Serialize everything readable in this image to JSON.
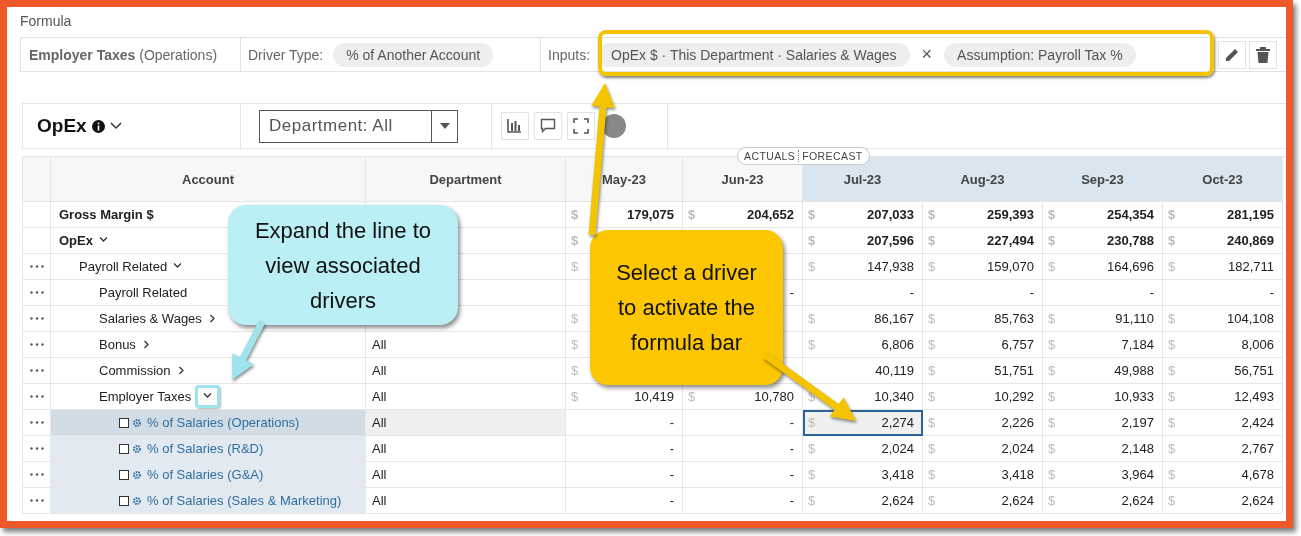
{
  "formula": {
    "title": "Formula",
    "account": "**Employer Taxes** (Operations)",
    "driver_type_label": "Driver Type:",
    "driver_type": "% of Another Account",
    "inputs_label": "Inputs:",
    "inputs": [
      {
        "text": "OpEx $ · This Department · Salaries & Wages"
      },
      {
        "text": "Assumption: Payroll Tax %"
      }
    ],
    "operator": "×"
  },
  "toolbar": {
    "title": "OpEx",
    "department_filter": "Department: All"
  },
  "table": {
    "period_divider": {
      "actuals": "ACTUALS",
      "forecast": "FORECAST"
    },
    "label_columns": [
      {
        "label": "Account"
      },
      {
        "label": "Department"
      }
    ],
    "period_columns": [
      {
        "label": "May-23",
        "kind": "actual"
      },
      {
        "label": "Jun-23",
        "kind": "actual"
      },
      {
        "label": "Jul-23",
        "kind": "forecast"
      },
      {
        "label": "Aug-23",
        "kind": "forecast"
      },
      {
        "label": "Sep-23",
        "kind": "forecast"
      },
      {
        "label": "Oct-23",
        "kind": "forecast"
      }
    ],
    "rows": [
      {
        "account": "Gross Margin $",
        "kind": "line",
        "bold": true,
        "dots": false,
        "cells": [
          {
            "currency": "$",
            "amount": "179,075"
          },
          {
            "currency": "$",
            "amount": "204,652"
          },
          {
            "currency": "$",
            "amount": "207,033"
          },
          {
            "currency": "$",
            "amount": "259,393"
          },
          {
            "currency": "$",
            "amount": "254,354"
          },
          {
            "currency": "$",
            "amount": "281,195"
          }
        ]
      },
      {
        "account": "OpEx",
        "kind": "group",
        "expanded": true,
        "bold": true,
        "dots": false,
        "cells": [
          {
            "currency": "$"
          },
          null,
          {
            "currency": "$",
            "amount": "207,596"
          },
          {
            "currency": "$",
            "amount": "227,494"
          },
          {
            "currency": "$",
            "amount": "230,788"
          },
          {
            "currency": "$",
            "amount": "240,869"
          }
        ],
        "children": [
          {
            "account": "Payroll Related",
            "kind": "group",
            "expanded": true,
            "bold": false,
            "dots": true,
            "cells": [
              {
                "currency": "$"
              },
              null,
              {
                "currency": "$",
                "amount": "147,938"
              },
              {
                "currency": "$",
                "amount": "159,070"
              },
              {
                "currency": "$",
                "amount": "164,696"
              },
              {
                "currency": "$",
                "amount": "182,711"
              }
            ],
            "children": [
              {
                "account": "Payroll Related",
                "kind": "line",
                "bold": false,
                "dots": true,
                "cells": [
                  null,
                  {
                    "amount": "-"
                  },
                  {
                    "amount": "-"
                  },
                  {
                    "amount": "-"
                  },
                  {
                    "amount": "-"
                  },
                  {
                    "amount": "-"
                  }
                ]
              },
              {
                "account": "Salaries & Wages",
                "kind": "group",
                "expanded": false,
                "bold": false,
                "dots": true,
                "cells": [
                  {
                    "currency": "$"
                  },
                  null,
                  {
                    "currency": "$",
                    "amount": "86,167"
                  },
                  {
                    "currency": "$",
                    "amount": "85,763"
                  },
                  {
                    "currency": "$",
                    "amount": "91,110"
                  },
                  {
                    "currency": "$",
                    "amount": "104,108"
                  }
                ]
              },
              {
                "account": "Bonus",
                "kind": "group",
                "expanded": false,
                "bold": false,
                "dots": true,
                "department": "All",
                "cells": [
                  {
                    "currency": "$"
                  },
                  null,
                  {
                    "currency": "$",
                    "amount": "6,806"
                  },
                  {
                    "currency": "$",
                    "amount": "6,757"
                  },
                  {
                    "currency": "$",
                    "amount": "7,184"
                  },
                  {
                    "currency": "$",
                    "amount": "8,006"
                  }
                ]
              },
              {
                "account": "Commission",
                "kind": "group",
                "expanded": false,
                "bold": false,
                "dots": true,
                "department": "All",
                "cells": [
                  {
                    "currency": "$"
                  },
                  null,
                  {
                    "amount": "40,119"
                  },
                  {
                    "currency": "$",
                    "amount": "51,751"
                  },
                  {
                    "currency": "$",
                    "amount": "49,988"
                  },
                  {
                    "currency": "$",
                    "amount": "56,751"
                  }
                ]
              },
              {
                "account": "Employer Taxes",
                "kind": "group",
                "expanded": true,
                "bold": false,
                "dots": true,
                "department": "All",
                "cells": [
                  {
                    "currency": "$",
                    "amount": "10,419"
                  },
                  {
                    "currency": "$",
                    "amount": "10,780"
                  },
                  {
                    "currency": "$",
                    "amount": "10,340"
                  },
                  {
                    "currency": "$",
                    "amount": "10,292"
                  },
                  {
                    "currency": "$",
                    "amount": "10,933"
                  },
                  {
                    "currency": "$",
                    "amount": "12,493"
                  }
                ],
                "children": [
                  {
                    "account": "% of Salaries (Operations)",
                    "kind": "driver",
                    "selected": true,
                    "checked": false,
                    "bold": false,
                    "dots": true,
                    "department": "All",
                    "cells": [
                      {
                        "amount": "-"
                      },
                      {
                        "amount": "-"
                      },
                      {
                        "currency": "$",
                        "amount": "2,274",
                        "selected": true
                      },
                      {
                        "currency": "$",
                        "amount": "2,226"
                      },
                      {
                        "currency": "$",
                        "amount": "2,197"
                      },
                      {
                        "currency": "$",
                        "amount": "2,424"
                      }
                    ]
                  },
                  {
                    "account": "% of Salaries (R&D)",
                    "kind": "driver",
                    "selected": false,
                    "checked": false,
                    "bold": false,
                    "dots": true,
                    "department": "All",
                    "cells": [
                      {
                        "amount": "-"
                      },
                      {
                        "amount": "-"
                      },
                      {
                        "currency": "$",
                        "amount": "2,024"
                      },
                      {
                        "currency": "$",
                        "amount": "2,024"
                      },
                      {
                        "currency": "$",
                        "amount": "2,148"
                      },
                      {
                        "currency": "$",
                        "amount": "2,767"
                      }
                    ]
                  },
                  {
                    "account": "% of Salaries (G&A)",
                    "kind": "driver",
                    "selected": false,
                    "checked": false,
                    "bold": false,
                    "dots": true,
                    "department": "All",
                    "cells": [
                      {
                        "amount": "-"
                      },
                      {
                        "amount": "-"
                      },
                      {
                        "currency": "$",
                        "amount": "3,418"
                      },
                      {
                        "currency": "$",
                        "amount": "3,418"
                      },
                      {
                        "currency": "$",
                        "amount": "3,964"
                      },
                      {
                        "currency": "$",
                        "amount": "4,678"
                      }
                    ]
                  },
                  {
                    "account": "% of Salaries (Sales & Marketing)",
                    "kind": "driver",
                    "selected": false,
                    "checked": false,
                    "bold": false,
                    "dots": true,
                    "department": "All",
                    "cells": [
                      {
                        "amount": "-"
                      },
                      {
                        "amount": "-"
                      },
                      {
                        "currency": "$",
                        "amount": "2,624"
                      },
                      {
                        "currency": "$",
                        "amount": "2,624"
                      },
                      {
                        "currency": "$",
                        "amount": "2,624"
                      },
                      {
                        "currency": "$",
                        "amount": "2,624"
                      }
                    ]
                  }
                ]
              }
            ]
          }
        ]
      }
    ]
  },
  "annotations": [
    {
      "kind": "callout",
      "text": "Expand the line to view associated drivers",
      "color": "#b9eff5"
    },
    {
      "kind": "callout",
      "text": "Select a driver to activate the formula bar",
      "color": "#fcc700"
    }
  ]
}
